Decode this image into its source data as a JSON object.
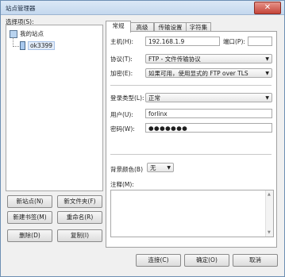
{
  "window": {
    "title": "站点管理器",
    "close_label": "✕"
  },
  "tree": {
    "label": "选择项(S):",
    "root": "我的站点",
    "site": "ok3399"
  },
  "left_buttons": {
    "new_site": "新站点(N)",
    "new_folder": "新文件夹(F)",
    "new_bookmark": "新建书签(M)",
    "rename": "重命名(R)",
    "delete": "删除(D)",
    "copy": "复制(I)"
  },
  "tabs": [
    "常规",
    "高级",
    "传输设置",
    "字符集"
  ],
  "general": {
    "host_label": "主机(H):",
    "host_value": "192.168.1.9",
    "port_label": "端口(P):",
    "port_value": "",
    "protocol_label": "协议(T):",
    "protocol_value": "FTP - 文件传输协议",
    "encryption_label": "加密(E):",
    "encryption_value": "如果可用，使用显式的 FTP over TLS",
    "logon_label": "登录类型(L):",
    "logon_value": "正常",
    "user_label": "用户(U):",
    "user_value": "forlinx",
    "password_label": "密码(W):",
    "password_value": "●●●●●●●",
    "bgcolor_label": "背景颜色(B)",
    "bgcolor_value": "无",
    "comments_label": "注释(M):",
    "comments_value": ""
  },
  "bottom_buttons": {
    "connect": "连接(C)",
    "ok": "确定(O)",
    "cancel": "取消"
  }
}
